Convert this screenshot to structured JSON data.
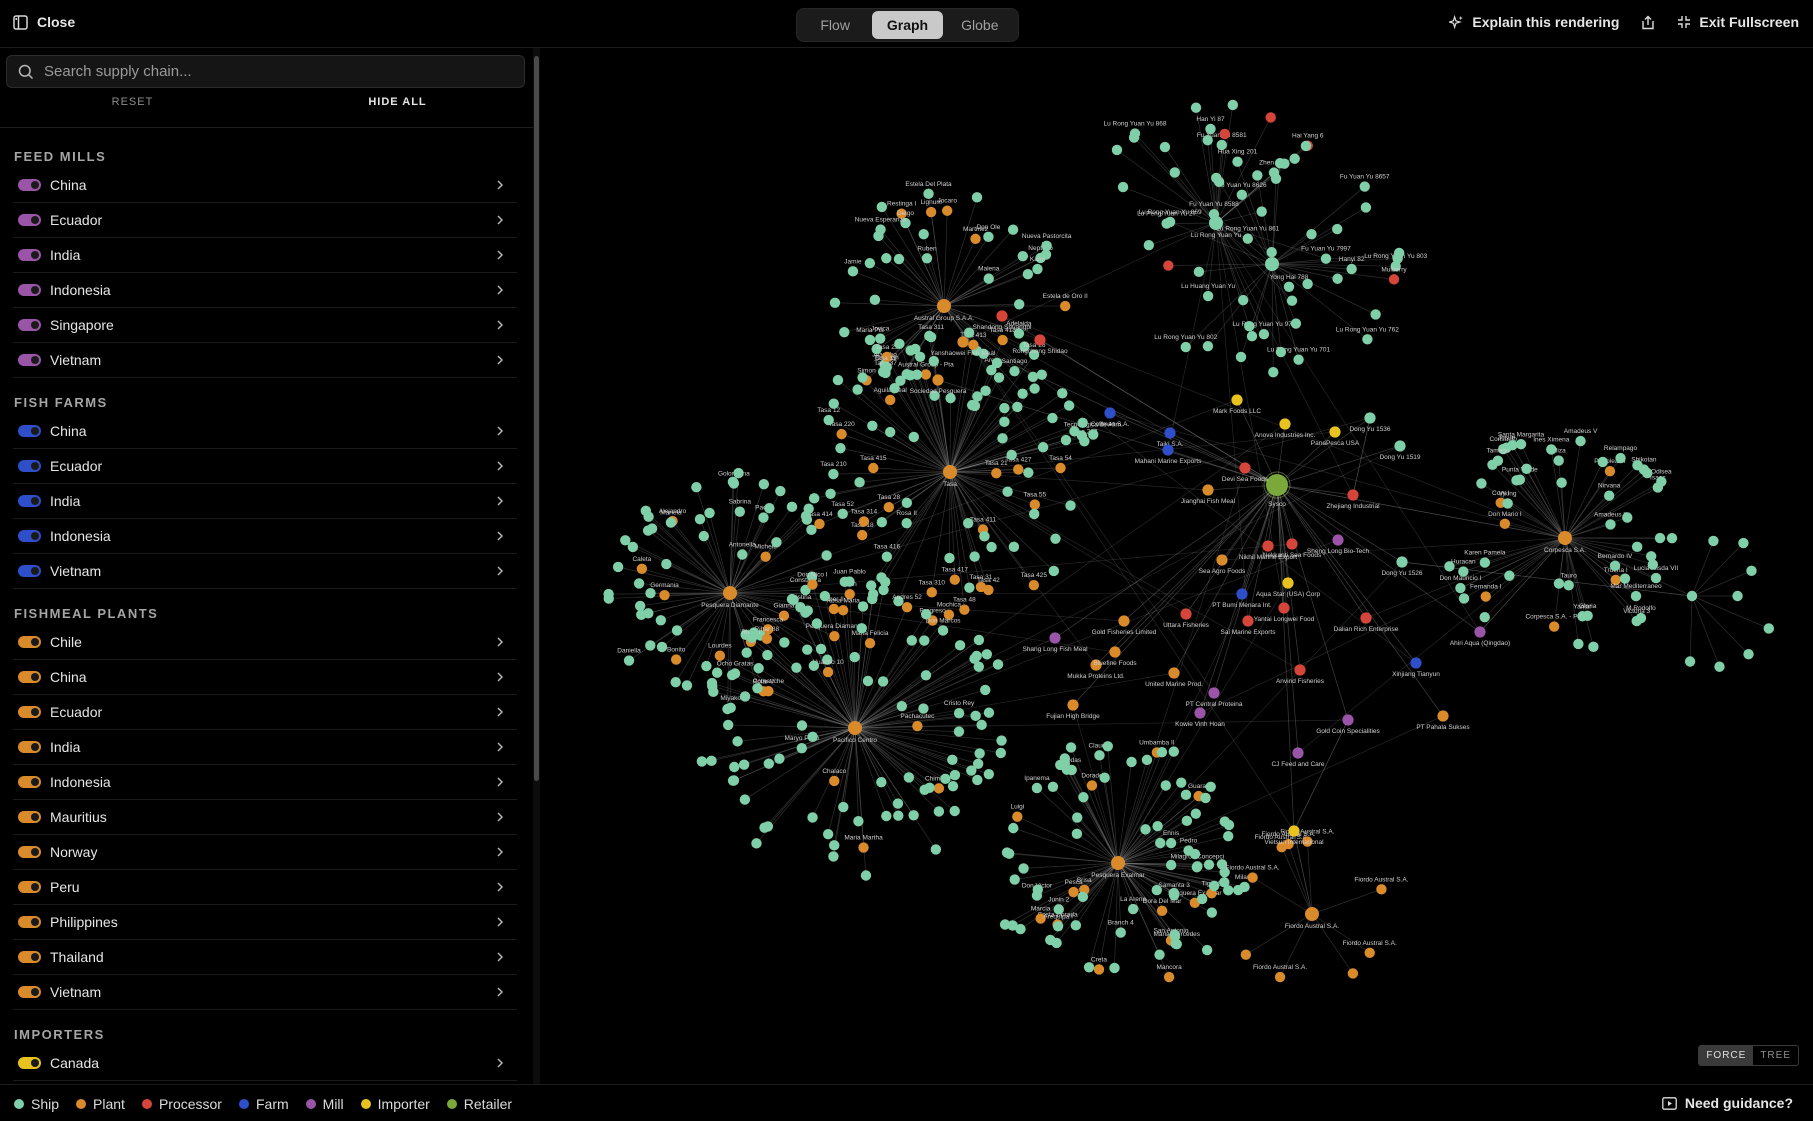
{
  "topbar": {
    "close_label": "Close",
    "tabs": [
      {
        "label": "Flow",
        "active": false
      },
      {
        "label": "Graph",
        "active": true
      },
      {
        "label": "Globe",
        "active": false
      }
    ],
    "explain_label": "Explain this rendering",
    "exit_label": "Exit Fullscreen"
  },
  "sidebar": {
    "search_placeholder": "Search supply chain...",
    "reset_label": "RESET",
    "hide_all_label": "HIDE ALL",
    "groups": [
      {
        "title": "FEED MILLS",
        "color": "#9b55a8",
        "items": [
          "China",
          "Ecuador",
          "India",
          "Indonesia",
          "Singapore",
          "Vietnam"
        ]
      },
      {
        "title": "FISH FARMS",
        "color": "#2f4ec9",
        "items": [
          "China",
          "Ecuador",
          "India",
          "Indonesia",
          "Vietnam"
        ]
      },
      {
        "title": "FISHMEAL PLANTS",
        "color": "#d98a2b",
        "items": [
          "Chile",
          "China",
          "Ecuador",
          "India",
          "Indonesia",
          "Mauritius",
          "Norway",
          "Peru",
          "Philippines",
          "Thailand",
          "Vietnam"
        ]
      },
      {
        "title": "IMPORTERS",
        "color": "#e8c21f",
        "items": [
          "Canada"
        ]
      }
    ]
  },
  "graph": {
    "clusters": [
      {
        "hub_label": "Austral Group S.A.A.",
        "hub_type": "Plant",
        "labels": [
          "Estela de Oro II",
          "Austral Group - Pta",
          "Lignum",
          "Aguila Real",
          "Jocaro",
          "Restinga I",
          "Martinez",
          "Simon",
          "Ruben",
          "Diego",
          "Pili",
          "Santiago",
          "Neptuno",
          "Nueva Esperanza",
          "Nueva Pastorcita",
          "Juancho",
          "Don Ole",
          "Arep",
          "Maria Pia",
          "Kaori",
          "Estela Del Plata",
          "Adelaida",
          "Jamie",
          "Jovica",
          "Malena",
          "Esteban"
        ]
      },
      {
        "hub_label": "Lu Rong Yuan Yu",
        "hub_type": "Processor",
        "labels": [
          "Hai Yang 6",
          "Fu Yuan Yu 8657",
          "Fu Yuan Yu 8581",
          "Hanyi 82",
          "Lu Rong Yuan Yu 861",
          "Fu Yuan Yu 8588",
          "Han Yi 87",
          "Fu Yuan Yu 8626",
          "Zhen Fa 7",
          "Lu Rong Yuan Yu 802",
          "Yong Hai 788",
          "Lu Rong Yuan Yu 803",
          "Lu Rong Yuan Yu 868",
          "Mulberry",
          "Lu Rong Yuan Yu 977",
          "Lu Rong Yuan Yu 869",
          "Lu Huang Yuan Yu",
          "Lu Rong Yuan Yu 701",
          "Fu Yuan Yu 7997",
          "Hua Xing 201",
          "Lu Peng Yuan Yu 27",
          "Lu Rong Yuan Yu 762"
        ]
      },
      {
        "hub_label": "Tasa",
        "hub_type": "Plant",
        "labels": [
          "Tasa 42",
          "Tasa 417",
          "Tasa 54",
          "Tasa 23",
          "Tasa 18",
          "Tasa 55",
          "Tasa 418",
          "Tasa 425",
          "Tasa 415",
          "Tasa 31",
          "Tasa 411",
          "Tasa 310",
          "Tasa 220",
          "Tasa 427",
          "Tasa 314",
          "Tasa 21",
          "Tasa 28",
          "Tasa 48",
          "Tasa 413",
          "Tasa 414",
          "Tasa 212",
          "Tasa 37",
          "Tasa 416",
          "Tasa 210",
          "Tasa 12",
          "Tasa 15",
          "Tasa 311",
          "Tasa 26",
          "Tasa 52",
          "Tecnologica de Alim.",
          "Rosa II"
        ]
      },
      {
        "hub_label": "Pesquera Diamante",
        "hub_type": "Plant",
        "labels": [
          "Pesquera Diamante",
          "Alejandro",
          "Caleta",
          "Germania",
          "Gianna",
          "Bonito",
          "Polar V",
          "Francesca",
          "Juan",
          "Michele",
          "Sabrina",
          "Daniella",
          "Antonella",
          "Constanza",
          "Mariela",
          "Cristina",
          "Golondrina",
          "Miyako",
          "Paola"
        ]
      },
      {
        "hub_label": "Pacifico Centro",
        "hub_type": "Plant",
        "labels": [
          "Pachacutec",
          "Chimbote",
          "Mochica",
          "Tiger II",
          "Maria Martha",
          "Maria Felicia",
          "Andres 52",
          "Lourdes",
          "Chalaco",
          "Rosa Maria",
          "Ribar I",
          "Huacho 10",
          "Don Nico I",
          "Progreso",
          "Comanche",
          "Ribar 88",
          "Maryo Poko",
          "Don Marcos",
          "Cristo Rey",
          "Juan Pablo",
          "Ocho Gratas"
        ]
      },
      {
        "hub_label": "Pesquera Exalmar",
        "hub_type": "Plant",
        "labels": [
          "Pesquera Exalmar",
          "Costa Dorada",
          "Brisa",
          "Marcia",
          "Umbamba II",
          "Tigre 8",
          "Luigi",
          "Dora Del Mar",
          "Pesca",
          "Creta",
          "Mancora",
          "Guaray",
          "San Antonio",
          "Dorado",
          "Don Victor",
          "Junin 2",
          "Milagros Concepci",
          "Ipanema",
          "Milano",
          "Samanta 3",
          "Claudia",
          "Rodas",
          "Ennis",
          "Branch 4",
          "Arequipa I",
          "La Arena",
          "Maria Mercedes",
          "Pedro"
        ]
      },
      {
        "hub_label": "Corpesca S.A.",
        "hub_type": "Plant",
        "labels": [
          "Corpesca S.A. - Pta",
          "Don Mario I",
          "Cory I",
          "Fernanda I",
          "Petrolea III",
          "Truena I",
          "Tauro",
          "Isaac",
          "Consuelo",
          "Lucia Alisda VII",
          "Nirvana",
          "Karen Pamela",
          "Amadeus V",
          "Amadeus II",
          "M Rodolfo",
          "Relampago",
          "Mar Mediterraneo",
          "Huracan",
          "Punta Verde",
          "Bernardo IV",
          "Don Mauricio I",
          "Josue",
          "Odisea",
          "Eliza",
          "Santa Margarita",
          "Ines Ximena",
          "Tamago",
          "Viking",
          "Shikotan",
          "Gloria",
          "Victoria 3",
          "Yanlar"
        ]
      },
      {
        "hub_label": "Fiordo Austral S.A.",
        "hub_type": "Plant",
        "labels": [
          "Fiordo Austral S.A.",
          "Fiordo Austral S.A.",
          "Fiordo Austral S.A.",
          "Fiordo Austral S.A.",
          "Fiordo Austral S.A.",
          "Fiordo Austral S.A.",
          "Fiordo Austral S.A."
        ]
      }
    ],
    "connectors": [
      {
        "label": "Sysco",
        "type": "Retailer"
      },
      {
        "label": "Zhejiang Industrial",
        "type": "Processor"
      },
      {
        "label": "PanaPesca USA",
        "type": "Importer"
      },
      {
        "label": "Dong Yu 1536",
        "type": "Ship"
      },
      {
        "label": "Dong Yu 1519",
        "type": "Ship"
      },
      {
        "label": "Dong Yu 1526",
        "type": "Ship"
      },
      {
        "label": "Shandong Shuangpi",
        "type": "Processor"
      },
      {
        "label": "Rongcheng Shidao",
        "type": "Processor"
      },
      {
        "label": "Yanshaowei Fish Meal",
        "type": "Plant"
      },
      {
        "label": "Sociedad Pesquera",
        "type": "Plant"
      },
      {
        "label": "Mark Foods LLC",
        "type": "Importer"
      },
      {
        "label": "Anova Industries Inc.",
        "type": "Importer"
      },
      {
        "label": "Devi Sea Foods",
        "type": "Processor"
      },
      {
        "label": "Coffman S.A.",
        "type": "Farm"
      },
      {
        "label": "Taiki S.A.",
        "type": "Farm"
      },
      {
        "label": "Mahani Marine Exports",
        "type": "Farm"
      },
      {
        "label": "Jianghai Fish Meal",
        "type": "Plant"
      },
      {
        "label": "Nekkanti Sea Foods",
        "type": "Processor"
      },
      {
        "label": "Sheng Long Bio-Tech",
        "type": "Mill"
      },
      {
        "label": "Aqua Star (USA) Corp",
        "type": "Importer"
      },
      {
        "label": "Dalian Rich Enterprise",
        "type": "Processor"
      },
      {
        "label": "Xinjiang Tianyun",
        "type": "Farm"
      },
      {
        "label": "Yantai Longwei Food",
        "type": "Processor"
      },
      {
        "label": "Anvind Fisheries",
        "type": "Processor"
      },
      {
        "label": "PT Bumi Menara Int.",
        "type": "Farm"
      },
      {
        "label": "Gold Coin Specialities",
        "type": "Mill"
      },
      {
        "label": "PT Pahala Sukses",
        "type": "Plant"
      },
      {
        "label": "CJ Feed and Care",
        "type": "Mill"
      },
      {
        "label": "Vietsun International",
        "type": "Importer"
      },
      {
        "label": "Ahiri Aqua (Qingdao)",
        "type": "Mill"
      },
      {
        "label": "Mukka Proteins Ltd.",
        "type": "Plant"
      },
      {
        "label": "Bluefine Foods",
        "type": "Plant"
      },
      {
        "label": "United Marine Prod.",
        "type": "Plant"
      },
      {
        "label": "Fujian High Bridge",
        "type": "Plant"
      },
      {
        "label": "Kowie Vinh Hoan",
        "type": "Mill"
      },
      {
        "label": "PT Central Proteina",
        "type": "Mill"
      },
      {
        "label": "Sai Marine Exports",
        "type": "Processor"
      },
      {
        "label": "Uttara Fisheries",
        "type": "Processor"
      },
      {
        "label": "Gold Fisheries Limited",
        "type": "Plant"
      },
      {
        "label": "Shang Long Fish Meal",
        "type": "Mill"
      },
      {
        "label": "Nikhil Marine Export",
        "type": "Processor"
      },
      {
        "label": "Sea Agro Foods",
        "type": "Plant"
      }
    ]
  },
  "layout_toggle": {
    "force_label": "FORCE",
    "tree_label": "TREE"
  },
  "legend": [
    {
      "label": "Ship",
      "color": "#7fcfa8"
    },
    {
      "label": "Plant",
      "color": "#d98a2b"
    },
    {
      "label": "Processor",
      "color": "#d6453a"
    },
    {
      "label": "Farm",
      "color": "#2f4ec9"
    },
    {
      "label": "Mill",
      "color": "#9b55a8"
    },
    {
      "label": "Importer",
      "color": "#e8c21f"
    },
    {
      "label": "Retailer",
      "color": "#7aa83a"
    }
  ],
  "guidance_label": "Need guidance?"
}
